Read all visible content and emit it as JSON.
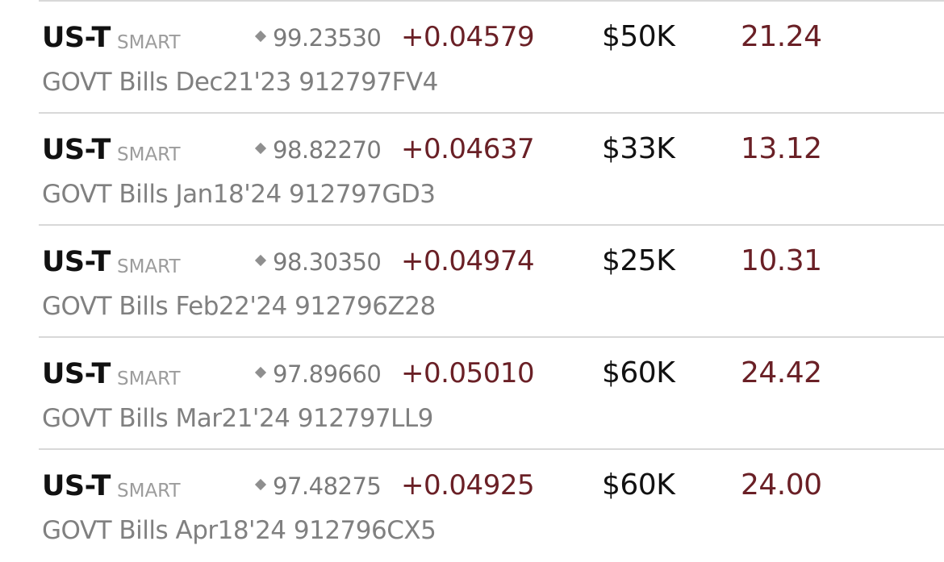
{
  "rows": [
    {
      "symbol": "US-T",
      "exchange": "SMART",
      "price": "99.23530",
      "change": "+0.04579",
      "position": "$50K",
      "value": "21.24",
      "description": "GOVT Bills Dec21'23 912797FV4"
    },
    {
      "symbol": "US-T",
      "exchange": "SMART",
      "price": "98.82270",
      "change": "+0.04637",
      "position": "$33K",
      "value": "13.12",
      "description": "GOVT Bills Jan18'24 912797GD3"
    },
    {
      "symbol": "US-T",
      "exchange": "SMART",
      "price": "98.30350",
      "change": "+0.04974",
      "position": "$25K",
      "value": "10.31",
      "description": "GOVT Bills Feb22'24 912796Z28"
    },
    {
      "symbol": "US-T",
      "exchange": "SMART",
      "price": "97.89660",
      "change": "+0.05010",
      "position": "$60K",
      "value": "24.42",
      "description": "GOVT Bills Mar21'24 912797LL9"
    },
    {
      "symbol": "US-T",
      "exchange": "SMART",
      "price": "97.48275",
      "change": "+0.04925",
      "position": "$60K",
      "value": "24.00",
      "description": "GOVT Bills Apr18'24 912796CX5"
    }
  ],
  "colors": {
    "change": "#6a2026",
    "value": "#6a2026",
    "primary_text": "#111111",
    "secondary_text": "#808080"
  },
  "icons": {
    "price_marker": "diamond-icon"
  }
}
